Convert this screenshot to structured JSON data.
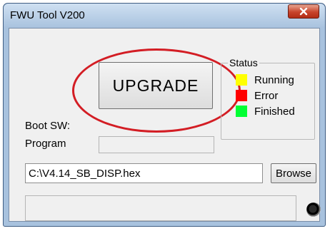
{
  "window": {
    "title": "FWU Tool V200",
    "close_icon": "close-icon"
  },
  "main": {
    "upgrade_label": "UPGRADE",
    "boot_sw_label": "Boot SW:",
    "program_label": "Program",
    "program_value": "",
    "file_path": "C:\\V4.14_SB_DISP.hex",
    "browse_label": "Browse",
    "status_message": "",
    "indicator_icon": "status-led-icon"
  },
  "status_group": {
    "label": "Status",
    "items": [
      {
        "label": "Running",
        "color": "#ffff00"
      },
      {
        "label": "Error",
        "color": "#ff0000"
      },
      {
        "label": "Finished",
        "color": "#00ff33"
      }
    ]
  },
  "annotation": {
    "highlight_color": "#d31d24"
  }
}
